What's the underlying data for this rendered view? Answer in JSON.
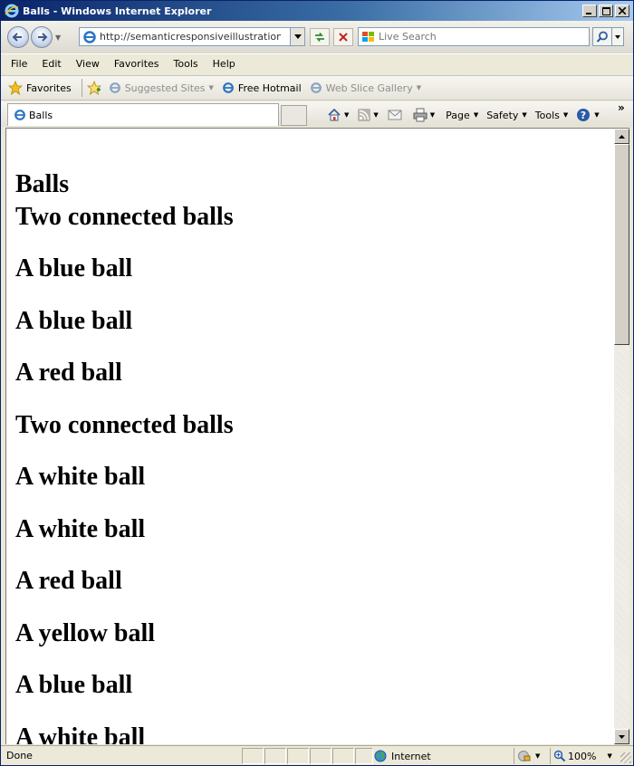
{
  "window": {
    "title": "Balls - Windows Internet Explorer",
    "minimize_icon": "minimize-icon",
    "maximize_icon": "maximize-icon",
    "close_icon": "close-icon"
  },
  "address_bar": {
    "url": "http://semanticresponsiveillustration.com/"
  },
  "search": {
    "placeholder": "Live Search"
  },
  "menu": {
    "items": [
      "File",
      "Edit",
      "View",
      "Favorites",
      "Tools",
      "Help"
    ]
  },
  "favorites_bar": {
    "favorites_label": "Favorites",
    "links": [
      {
        "label": "Suggested Sites",
        "has_dropdown": true,
        "muted": true
      },
      {
        "label": "Free Hotmail",
        "has_dropdown": false,
        "muted": false
      },
      {
        "label": "Web Slice Gallery",
        "has_dropdown": true,
        "muted": true
      }
    ]
  },
  "tab": {
    "label": "Balls"
  },
  "command_bar": {
    "page_label": "Page",
    "safety_label": "Safety",
    "tools_label": "Tools",
    "more_label": "»"
  },
  "page": {
    "headings": [
      "Balls",
      "Two connected balls",
      "A blue ball",
      "A blue ball",
      "A red ball",
      "Two connected balls",
      "A white ball",
      "A white ball",
      "A red ball",
      "A yellow ball",
      "A blue ball",
      "A white ball"
    ]
  },
  "status_bar": {
    "status": "Done",
    "zone": "Internet",
    "zoom": "100%"
  },
  "colors": {
    "titlebar_start": "#0a246a",
    "titlebar_end": "#a6caf0",
    "chrome": "#ece9d8"
  }
}
